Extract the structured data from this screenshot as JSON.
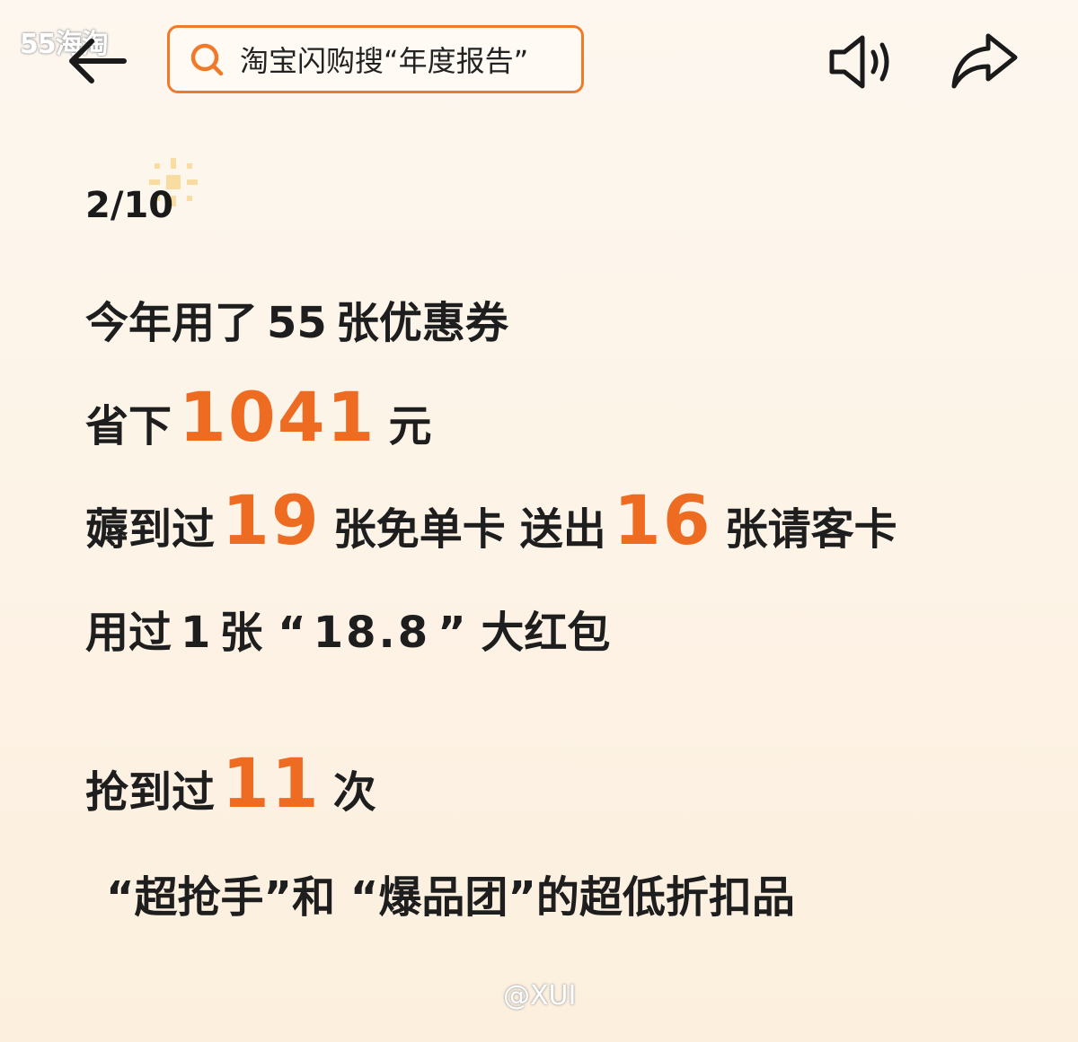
{
  "watermark_top": "55海淘",
  "watermark_bottom": "@XUI",
  "header": {
    "search_text": "淘宝闪购搜“年度报告”"
  },
  "page_indicator": "2/10",
  "report": {
    "line1": {
      "prefix": "今年用了",
      "count": "55",
      "suffix": "张优惠券"
    },
    "line2": {
      "prefix": "省下",
      "amount": "1041",
      "suffix": "元"
    },
    "line3": {
      "prefix": "薅到过",
      "free_cards": "19",
      "mid": "张免单卡",
      "mid2": "送出",
      "treat_cards": "16",
      "suffix": "张请客卡"
    },
    "line4": {
      "prefix": "用过",
      "count": "1",
      "mid": "张 “",
      "value": "18.8",
      "suffix": "” 大红包"
    },
    "line5": {
      "prefix": "抢到过",
      "times": "11",
      "suffix": "次"
    },
    "line6": "“超抢手”和 “爆品团”的超低折扣品"
  },
  "colors": {
    "accent": "#ee6c22",
    "search_border": "#f07a2a",
    "text": "#1e1e1e"
  },
  "icons": [
    "back-arrow-icon",
    "search-icon",
    "sound-icon",
    "share-icon",
    "sun-icon"
  ]
}
